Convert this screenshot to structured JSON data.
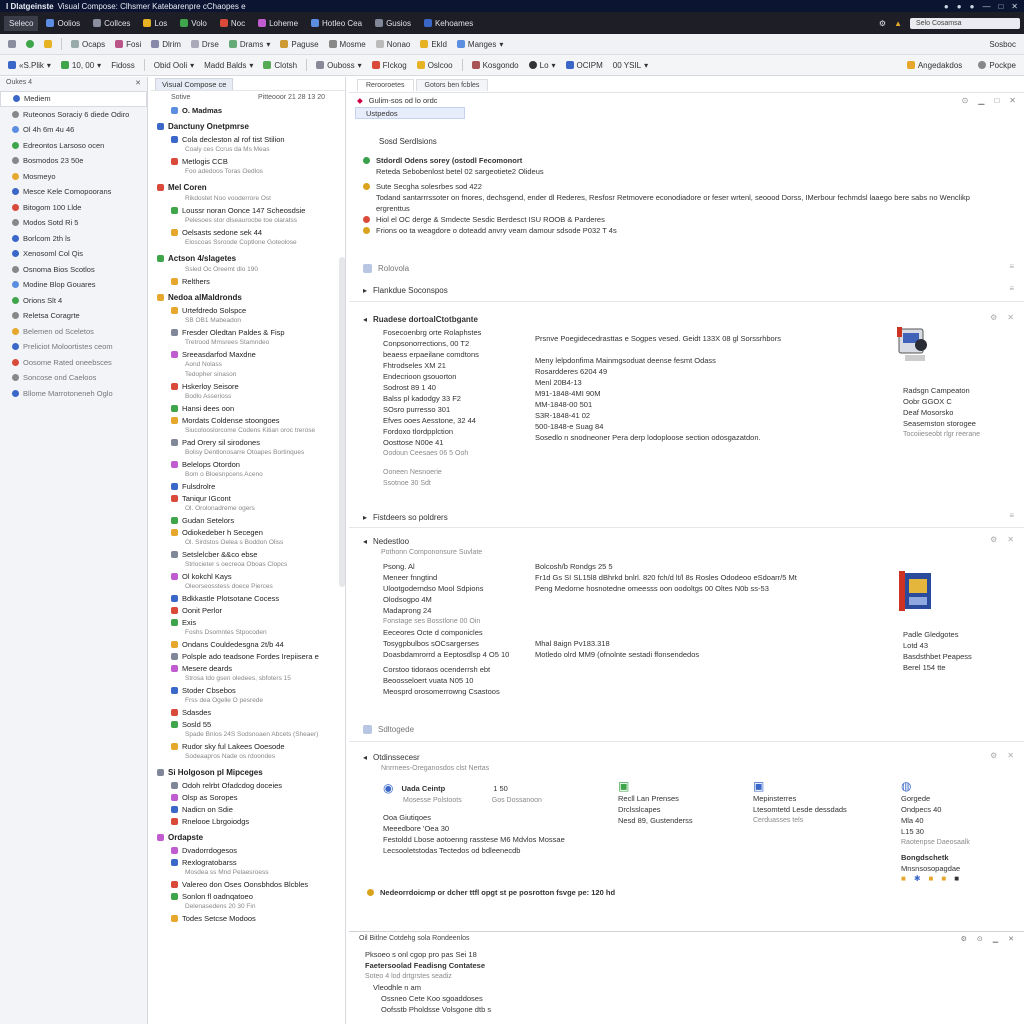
{
  "titlebar": {
    "app": "I Dlatgeinste",
    "title": "Visual Compose: Clhsmer Katebarenpre cChaopes e",
    "icons": [
      "●",
      "●",
      "●",
      "—",
      "□",
      "✕"
    ]
  },
  "menubar": {
    "items": [
      "Seleco",
      "Oolios",
      "Collces",
      "Los",
      "Volo",
      "Noc",
      "Loheme",
      "Hotleo Cea",
      "Gusios",
      "Kehoames"
    ],
    "search_placeholder": "Selo Cosamsa"
  },
  "toolbar1": {
    "items": [
      "Ocaps",
      "Fosi",
      "Dlrim",
      "Drse",
      "Drams",
      "Paguse",
      "Mosme",
      "Nonao",
      "Ekld",
      "Manges"
    ],
    "right": "Sosboc"
  },
  "toolbar2": {
    "items": [
      "«S.Plik",
      "10, 00",
      "Fidoss",
      "Obid Ooli",
      "Madd Balds",
      "Clotsh",
      "Ouboss",
      "FIckog",
      "Oslcoo",
      "Kosgondo",
      "Lo",
      "OCIPM",
      "00 YSIL"
    ],
    "right1": "Angedakdos",
    "right2": "Pockpe"
  },
  "left_panel": {
    "header": "Oukes 4",
    "items": [
      {
        "label": "Mediem",
        "sel": true
      },
      {
        "label": "Ruteonos Soraciy 6 diede Odiro"
      },
      {
        "label": "Ol 4h 6m 4u 46"
      },
      {
        "label": "Edreontos Larsoso ocen"
      },
      {
        "label": "Bosmodos 23 50e"
      },
      {
        "label": "Mosmeyo"
      },
      {
        "label": "Mesce Kele Comopoorans"
      },
      {
        "label": "Bitogom 100 Llde"
      },
      {
        "label": "Modos Sotd Ri 5"
      },
      {
        "label": "Borlcom 2th ls"
      },
      {
        "label": "Xenosoml Col Qis"
      },
      {
        "label": "Osnoma Bios Scotlos"
      },
      {
        "label": "Modine Blop Gouares"
      },
      {
        "label": "Orions Slt 4"
      },
      {
        "label": "Reletsa Coragrte"
      },
      {
        "label": "Belemen od Sceletos",
        "faded": true
      },
      {
        "label": "Preliciot Moloortistes ceom",
        "faded": true
      },
      {
        "label": "Oosome Rated oneebsces",
        "faded": true
      },
      {
        "label": "Soncose ond Caeloos",
        "faded": true
      },
      {
        "label": "Bllome Marrotoneneh Oglo",
        "faded": true
      }
    ]
  },
  "mid_panel": {
    "tab": "Visual Compose ce",
    "subhead_left": "Sotive",
    "subhead_right": "Pitteooor 21 28 13 20",
    "top_item": "O. Madmas",
    "groups": [
      {
        "title": "Danctuny Onetpmrse",
        "items": [
          {
            "label": "Cola decleston al rof tist Stilion",
            "sub": "Coaly ces Ccrus da Ms Meas"
          },
          {
            "label": "Metlogis CCB",
            "sub": "Foo adedoos Toras Oedlos"
          }
        ]
      },
      {
        "title": "Mel Coren",
        "items": [
          {
            "label": "",
            "sub": "Rikdostet Noo vooderrore Ost"
          },
          {
            "label": "Loussr noran Oonce 147 Scheosdsie",
            "sub": "Pelesoes stor dlseaurocbe toe olaratss"
          },
          {
            "label": "Oelsasts sedone sek 44",
            "sub": "Eloscoas Ssroode Coptlone Goteolose"
          }
        ]
      },
      {
        "title": "Actson 4/slagetes",
        "items": [
          {
            "label": "",
            "sub": "Ssled Oc Oreemt dlo 190"
          },
          {
            "label": "Relthers",
            "sub": ""
          }
        ]
      },
      {
        "title": "Nedoa alMaldronds",
        "items": [
          {
            "label": "Urtefdredo Solspce",
            "sub": "SB OB1 Mabeadon"
          },
          {
            "label": "Fresder Oledtan Paldes & Fisp",
            "sub": "Tretrood Mmsrees Stamndeo"
          },
          {
            "label": "Sreeasdarfod Maxdne",
            "sub": "Aond Nolass"
          },
          {
            "label": "",
            "sub": "Tedopher sinason"
          },
          {
            "label": "Hskerloy Seisore",
            "sub": "Bodlo Asserioss"
          },
          {
            "label": "Hansi dees oon",
            "sub": ""
          },
          {
            "label": "Mordats Coldense stoongoes",
            "sub": "Siucolooslorcome Codens Kitian oroc trerose"
          },
          {
            "label": "Pad Orery sil sirodones",
            "sub": "Bolisy Dentlonosarre Otoapes Bortinques"
          },
          {
            "label": "Belelops Otordon",
            "sub": "Bom o Bloesnpcens Aceno"
          },
          {
            "label": "Fulsdrolre",
            "sub": ""
          },
          {
            "label": "Taniqur IGcont",
            "sub": "Ol. Orolonadreme ogers"
          },
          {
            "label": "Gudan Setelors",
            "sub": ""
          },
          {
            "label": "Odiokedeber h Secegen",
            "sub": "Ol. Sirdstos Oelea s Boddon Oliss"
          },
          {
            "label": "Setslelcber &&co ebse",
            "sub": "Strlocieter s oecreoa Oboas Clopcs"
          },
          {
            "label": "Ol kokchl Kays",
            "sub": "Oleorseosstess doece Pierces"
          },
          {
            "label": "Bdkkastle Plotsotane Cocess",
            "sub": ""
          },
          {
            "label": "Oonit Perlor",
            "sub": ""
          },
          {
            "label": "Exis",
            "sub": "Foshs Dsomntes Stpocoden"
          },
          {
            "label": "Ondans Couldedesgna 2t/b 44",
            "sub": ""
          },
          {
            "label": "Polsple ado teadsone Fordes Irepiisera e",
            "sub": ""
          },
          {
            "label": "Mesere deards",
            "sub": "Strosa tdo gsen oledees, sbfoters 15"
          },
          {
            "label": "Stoder Cbsebos",
            "sub": "Frss dea Ogelle O pesrede"
          },
          {
            "label": "Sdasdes",
            "sub": ""
          },
          {
            "label": "Sosld 55",
            "sub": "Spade Bnlos 24S Sodsnoaen Abcets (Sheaer)"
          },
          {
            "label": "Rudor sky ful Lakees Ooesode",
            "sub": "Sodeaapros Nade os rdoondes"
          }
        ]
      },
      {
        "title": "Si Holgoson pl Mipceges",
        "items": [
          {
            "label": "Odoh relrbt Ofadcdog doceies",
            "sub": ""
          },
          {
            "label": "Olsp as Soropes",
            "sub": ""
          },
          {
            "label": "Nadicn on Sdie",
            "sub": ""
          },
          {
            "label": "Rnelooe Lbrgoiodgs",
            "sub": ""
          }
        ]
      },
      {
        "title": "Ordapste",
        "items": [
          {
            "label": "Dvadorrdogesos",
            "sub": ""
          },
          {
            "label": "Rexlogratobarss",
            "sub": "Mosdea ss Mnd Pelaesroess"
          },
          {
            "label": "Valereo don Oses Oonsbhdos Blcbles",
            "sub": ""
          },
          {
            "label": "Sonlon fl oadnqatoeo",
            "sub": "Delenasedens 20 30 Fin"
          },
          {
            "label": "Todes Setcse Modoos",
            "sub": ""
          }
        ]
      }
    ]
  },
  "main": {
    "tabs": [
      "Rerooroetes",
      "Gotors ben fcbles"
    ],
    "doc_title": "Gulim-sos od lo ordc",
    "selected_strip": "Ustpedos",
    "sections": {
      "s1": {
        "title": "Sosd Serdlsions",
        "lines": [
          {
            "t": "Stdordl Odens sorey (ostodl Fecomonort",
            "b": true
          },
          {
            "t": "Reteda Sebobenlost betel 02 sargeotiete2 Olideus"
          },
          {
            "t": "Sute Secgha solesrbes sod 422",
            "b": true
          },
          {
            "t": "Todand santarrrssoter on fnores, dechsgend, ender dl Rederes, Resfosr Retmovere econodiadore or feser wrtenl, seoood Dorss, IMerbour fechmdsl laaego bere sabs no Wenclikp"
          },
          {
            "t": "ergrenttus"
          },
          {
            "t": "Hiol el OC derge & Smdecte Sesdic Berdesct ISU ROOB & Parderes",
            "b": true
          },
          {
            "t": "Frions oo ta weagdore o doteadd anvry veam damour sdsode P032 T 4s",
            "b": true
          }
        ]
      },
      "s2": {
        "title": "Rolovola"
      },
      "s3": {
        "title": "Flankdue Soconspos"
      },
      "s4": {
        "title": "Ruadese dortoalCtotbgante",
        "left_lines": [
          "Fosecoenbrg orte Rolaphstes",
          "Conpsonorrections, 00 T2",
          "beaess erpaeilane comdtons",
          "Fhtrodseles XM 21",
          "Endecrioon gsouorton",
          "Sodrost 89 1 40",
          "Balss pl kadodgy 33 F2",
          "SOsro purresso 301",
          "Efves ooes Aesstone, 32 44",
          "Fordoxo tlordpplction",
          "Oosttose N00e 41"
        ],
        "left_muted": "Oodoun Ceesaes 06 5 Ooh",
        "mid_lines": [
          "Prsnve Poegidecedrasttas e Sogpes vesed. Geidt 133X 08 gl Sorssrhbors",
          "",
          "Meny lelpdonfima Mainmgsoduat deense fesmt Odass",
          "Rosardderes 6204 49",
          "Menl 20B4-13",
          "M91-1848-4MI 90M",
          "MM-1848-00 501",
          "S3R-1848-41 02",
          "500-1848-e Suag 84",
          "Sosedlo n snodneoner Pera derp lodoploose section odosgazatdon."
        ],
        "right_lines": [
          "Radsgn Campeaton",
          "Oobr GGOX C",
          "Deaf Mosorsko",
          "Seasemston storogee"
        ],
        "right_muted": "Tocoiieseobt rlgr reerane",
        "tool_muted_1": "Ooneen Nesnoerie",
        "tool_muted_2": "Ssotnoe 30 Sdt"
      },
      "s5": {
        "title": "Fistdeers so poldrers"
      },
      "s6": {
        "title": "Nedestloo",
        "subtitle": "Pothonn Compononsure Suvlate",
        "left_lines": [
          "Psong. Al",
          "Meneer fnngtind",
          "Ulootgoderndso Mool Sdpions",
          "Olodsogpo 4M",
          "Madaprong 24"
        ],
        "left_muted": "Fonstage ses Bosstlone 00 Oin",
        "left_lines2": [
          "Eeceores Octe d componicles",
          "Tosygpbulbos sOCsargerses",
          "Doasbdamrorrd a Eeptosdlsp 4 O5 10"
        ],
        "left_lines3": [
          "Corstoo tidoraos ocenderrsh ebt",
          "Beoosseloert vuata N05 10",
          "Meosprd orosomerrowng Csastoos"
        ],
        "mid_lines": [
          "Bolcosh/b Rondgs 25 5",
          "Fr1d Gs SI SL15l8 dBhrkd bnlrl. 820 fch/d lt/l 8s Rosles Ododeoo eSdoarr/5 Mt",
          "Peng Medorne hosnotedne omeesss oon oodoltgs 00 Oltes N0b ss-53"
        ],
        "mid_lines2": [
          "Mhal 8aign Pv183.318",
          "Motledo olrd MM9 (ofnolnte sestadi ffonsendedos"
        ],
        "right_lines": [
          "Padle Gledgotes",
          "Lotd 43",
          "Basdsthbet Peapess",
          "Berel 154 tte"
        ]
      },
      "s7": {
        "title": "Sdltogede"
      },
      "s8": {
        "title": "Otdinssecesr",
        "subtitle": "Nnrrnees-Oreganosdos clst Nertas",
        "cards": [
          {
            "head": "Uada Ceintp",
            "head2": "1 50",
            "sub": "Mosesse Polstoots",
            "sub2": "Gos Dossanoon"
          },
          {
            "head": "Recll Lan Prenses",
            "lines": [
              "Drclsslcapes",
              "Nesd 89, Gustenderss"
            ]
          },
          {
            "head": "Mepinsterres",
            "lines": [
              "Ltesomtetd Lesde dessdads",
              "Cerduasses tels"
            ]
          },
          {
            "head": "Gorgede",
            "lines": [
              "Ondpecs 40",
              "Mla 40",
              "L15 30"
            ],
            "muted": "Raotenpse Daeosaalk"
          }
        ],
        "card1_lines": [
          "Ooa Giutiqoes",
          "Meeedbore 'Oea 30",
          "Festoldd Lbose aotoenng rasstese M6 Mdvlos Mossae",
          "Lecsooletstodas Tectedos od bdleenecdb"
        ],
        "alert": "Nedeorrdoicmp or dcher ttfl opgt st pe posrotton fsvge pe: 120 hd",
        "tag": "Bongdschetk",
        "tag2": "Mnsnsosopagdae"
      }
    },
    "footer": {
      "head": "Oil Bitlne Cotdehg sola Rondeenlos",
      "l1": "Pksoeo s onl cgop pro pas Sei 18",
      "l2": "Faetersoolad Feadisng Contatese",
      "l3": "Soteo 4 lod drtgrstes seadiz",
      "l4": "Vleodhle n am",
      "l5": "Ossneo Cete Koo sgoaddoses",
      "l6": "Oofsstb Pholdsse Volsgone dtb s"
    }
  },
  "colors": {
    "titlebar": "#0b1430",
    "menubar": "#1e1f26",
    "accent": "#3b67c9",
    "bullet": "#d9a31c"
  }
}
